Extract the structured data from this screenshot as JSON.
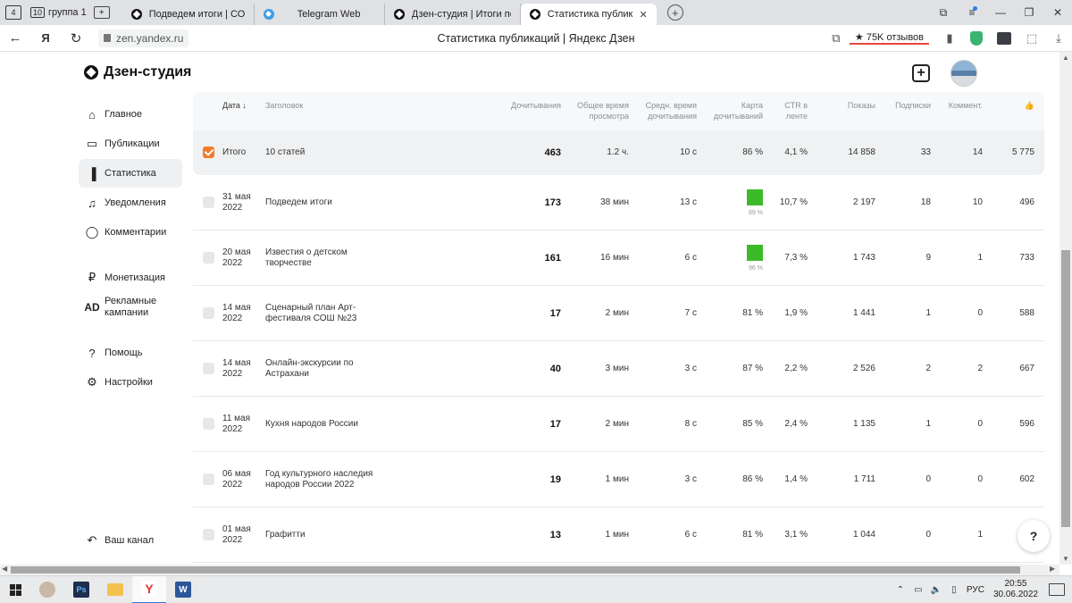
{
  "browser": {
    "tab_group_count": "10",
    "tab_group_label": "группа 1",
    "tabs": [
      {
        "title": "Подведем итоги | СОШ №",
        "icon": "zen-logo-icon"
      },
      {
        "title": "Telegram Web",
        "icon": "telegram-icon"
      },
      {
        "title": "Дзен-студия | Итоги попу",
        "icon": "zen-logo-icon"
      },
      {
        "title": "Статистика публикаций | Я",
        "icon": "zen-logo-icon",
        "active": true
      }
    ],
    "url": "zen.yandex.ru",
    "page_title": "Статистика публикаций | Яндекс Дзен",
    "reviews": "★ 75K отзывов"
  },
  "studio": {
    "logo": "Дзен-студия",
    "nav": [
      {
        "label": "Главное",
        "icon": "home-icon"
      },
      {
        "label": "Публикации",
        "icon": "publications-icon"
      },
      {
        "label": "Статистика",
        "icon": "chart-icon",
        "active": true
      },
      {
        "label": "Уведомления",
        "icon": "bell-icon"
      },
      {
        "label": "Комментарии",
        "icon": "comment-icon"
      },
      {
        "label": "Монетизация",
        "icon": "ruble-icon"
      },
      {
        "label": "Рекламные кампании",
        "icon": "ad-icon"
      },
      {
        "label": "Помощь",
        "icon": "help-icon"
      },
      {
        "label": "Настройки",
        "icon": "gear-icon"
      }
    ],
    "your_channel": "Ваш канал",
    "help_button": "?"
  },
  "table": {
    "headers": {
      "date": "Дата",
      "title": "Заголовок",
      "reads": "Дочитывания",
      "total_time": "Общее время просмотра",
      "avg_time": "Средн. время дочитывания",
      "read_map": "Карта дочитываний",
      "ctr": "CTR в ленте",
      "views": "Показы",
      "subs": "Подписки",
      "comments": "Коммент.",
      "likes": "👍"
    },
    "total": {
      "date": "Итого",
      "title": "10 статей",
      "reads": "463",
      "total_time": "1.2 ч.",
      "avg_time": "10 с",
      "read_map": "86 %",
      "ctr": "4,1 %",
      "views": "14 858",
      "subs": "33",
      "comments": "14",
      "likes": "5 775"
    },
    "rows": [
      {
        "date1": "31 мая",
        "date2": "2022",
        "title1": "Подведем итоги",
        "title2": "",
        "reads": "173",
        "total_time": "38 мин",
        "avg_time": "13 с",
        "read_map": "",
        "read_map_sub": "89 %",
        "ctr": "10,7 %",
        "views": "2 197",
        "subs": "18",
        "comments": "10",
        "likes": "496"
      },
      {
        "date1": "20 мая",
        "date2": "2022",
        "title1": "Известия о детском",
        "title2": "творчестве",
        "reads": "161",
        "total_time": "16 мин",
        "avg_time": "6 с",
        "read_map": "",
        "read_map_sub": "96 %",
        "ctr": "7,3 %",
        "views": "1 743",
        "subs": "9",
        "comments": "1",
        "likes": "733"
      },
      {
        "date1": "14 мая",
        "date2": "2022",
        "title1": "Сценарный план Арт-",
        "title2": "фестиваля СОШ №23",
        "reads": "17",
        "total_time": "2 мин",
        "avg_time": "7 с",
        "read_map": "81 %",
        "read_map_sub": "",
        "ctr": "1,9 %",
        "views": "1 441",
        "subs": "1",
        "comments": "0",
        "likes": "588"
      },
      {
        "date1": "14 мая",
        "date2": "2022",
        "title1": "Онлайн-экскурсии по",
        "title2": "Астрахани",
        "reads": "40",
        "total_time": "3 мин",
        "avg_time": "3 с",
        "read_map": "87 %",
        "read_map_sub": "",
        "ctr": "2,2 %",
        "views": "2 526",
        "subs": "2",
        "comments": "2",
        "likes": "667"
      },
      {
        "date1": "11 мая",
        "date2": "2022",
        "title1": "Кухня народов России",
        "title2": "",
        "reads": "17",
        "total_time": "2 мин",
        "avg_time": "8 с",
        "read_map": "85 %",
        "read_map_sub": "",
        "ctr": "2,4 %",
        "views": "1 135",
        "subs": "1",
        "comments": "0",
        "likes": "596"
      },
      {
        "date1": "06 мая",
        "date2": "2022",
        "title1": "Год культурного наследия",
        "title2": "народов России 2022",
        "reads": "19",
        "total_time": "1 мин",
        "avg_time": "3 с",
        "read_map": "86 %",
        "read_map_sub": "",
        "ctr": "1,4 %",
        "views": "1 711",
        "subs": "0",
        "comments": "0",
        "likes": "602"
      },
      {
        "date1": "01 мая",
        "date2": "2022",
        "title1": "Графитти",
        "title2": "",
        "reads": "13",
        "total_time": "1 мин",
        "avg_time": "6 с",
        "read_map": "81 %",
        "read_map_sub": "",
        "ctr": "3,1 %",
        "views": "1 044",
        "subs": "0",
        "comments": "1",
        "likes": "596"
      }
    ]
  },
  "taskbar": {
    "lang": "РУС",
    "time": "20:55",
    "date": "30.06.2022"
  },
  "colors": {
    "accent_checkbox": "#f07c2b",
    "read_map_green": "#3cba2a",
    "reviews_underline": "#e8483b"
  }
}
